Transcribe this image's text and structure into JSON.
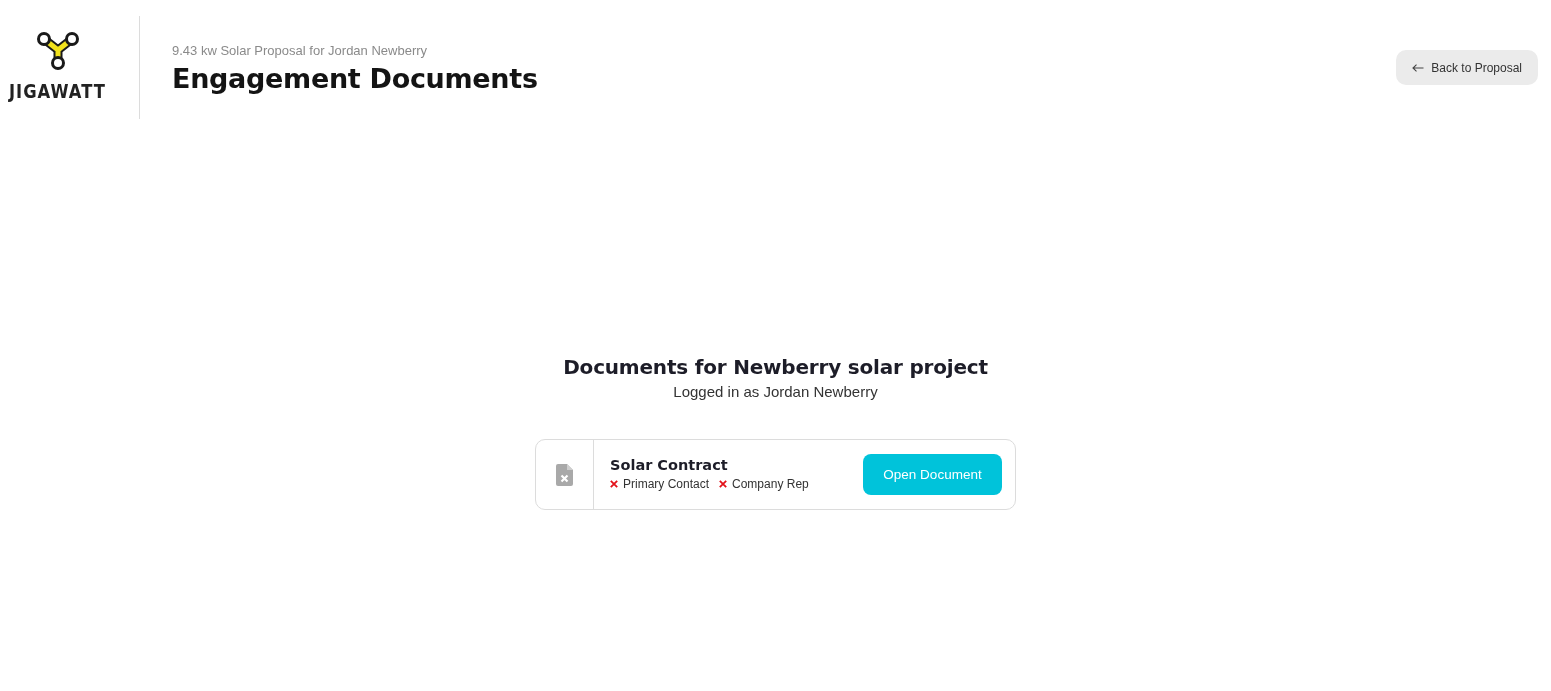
{
  "header": {
    "logo_text": "JIGAWATT",
    "subtitle": "9.43 kw Solar Proposal for Jordan Newberry",
    "title": "Engagement Documents",
    "back_button": {
      "label": "Back to Proposal"
    }
  },
  "main": {
    "heading": "Documents for Newberry solar project",
    "login_note": "Logged in as Jordan Newberry",
    "documents": [
      {
        "title": "Solar Contract",
        "signers": [
          {
            "role": "Primary Contact",
            "signed": false
          },
          {
            "role": "Company Rep",
            "signed": false
          }
        ],
        "action": "Open Document"
      }
    ]
  }
}
